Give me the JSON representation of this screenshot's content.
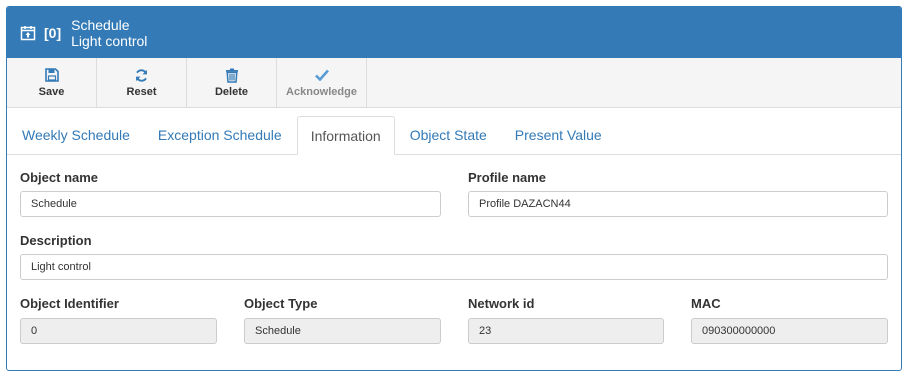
{
  "header": {
    "index": "[0]",
    "title": "Schedule",
    "subtitle": "Light control",
    "icon": "calendar-upload-icon"
  },
  "toolbar": {
    "save_label": "Save",
    "reset_label": "Reset",
    "delete_label": "Delete",
    "acknowledge_label": "Acknowledge"
  },
  "tabs": [
    {
      "label": "Weekly Schedule"
    },
    {
      "label": "Exception Schedule"
    },
    {
      "label": "Information"
    },
    {
      "label": "Object State"
    },
    {
      "label": "Present Value"
    }
  ],
  "active_tab": "Information",
  "form": {
    "object_name": {
      "label": "Object name",
      "value": "Schedule"
    },
    "profile_name": {
      "label": "Profile name",
      "value": "Profile DAZACN44"
    },
    "description": {
      "label": "Description",
      "value": "Light control"
    },
    "object_identifier": {
      "label": "Object Identifier",
      "value": "0"
    },
    "object_type": {
      "label": "Object Type",
      "value": "Schedule"
    },
    "network_id": {
      "label": "Network id",
      "value": "23"
    },
    "mac": {
      "label": "MAC",
      "value": "090300000000"
    }
  },
  "colors": {
    "primary": "#337ab7",
    "readonly_bg": "#eeeeee",
    "acknowledge_icon": "#5b9bd5"
  }
}
